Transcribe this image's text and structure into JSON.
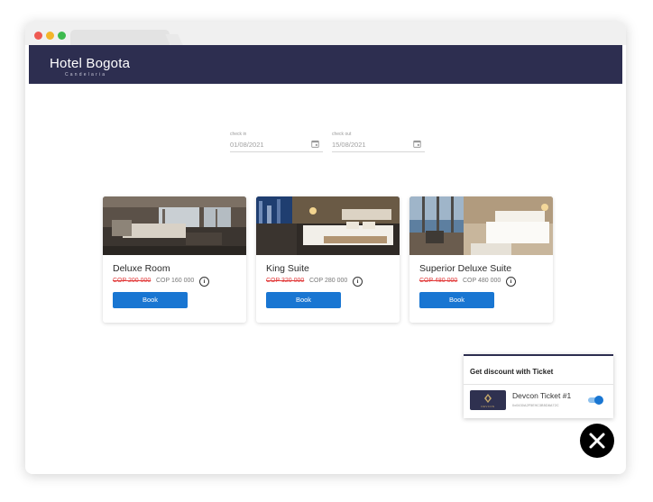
{
  "header": {
    "brand": "Hotel Bogota",
    "brand_sub": "Candelaria"
  },
  "dates": {
    "check_in": {
      "label": "check in",
      "value": "01/08/2021"
    },
    "check_out": {
      "label": "check out",
      "value": "15/08/2021"
    }
  },
  "rooms": [
    {
      "title": "Deluxe Room",
      "old_price": "COP 200 000",
      "price": "COP 160 000",
      "book_label": "Book"
    },
    {
      "title": "King Suite",
      "old_price": "COP 320 000",
      "price": "COP 280 000",
      "book_label": "Book"
    },
    {
      "title": "Superior Deluxe Suite",
      "old_price": "COP 480 000",
      "price": "COP 480 000",
      "book_label": "Book"
    }
  ],
  "ticket_panel": {
    "title": "Get discount with Ticket",
    "ticket_name": "Devcon Ticket #1",
    "ticket_id": "0x0430A2F5E9C3B5D8A72C",
    "thumb_text": "DEVCON",
    "enabled": true
  },
  "icons": {
    "calendar": "calendar-icon",
    "info": "info-icon",
    "close": "close-icon"
  },
  "colors": {
    "header": "#2d2e50",
    "accent": "#1976d2",
    "old_price": "#e23b3b"
  }
}
